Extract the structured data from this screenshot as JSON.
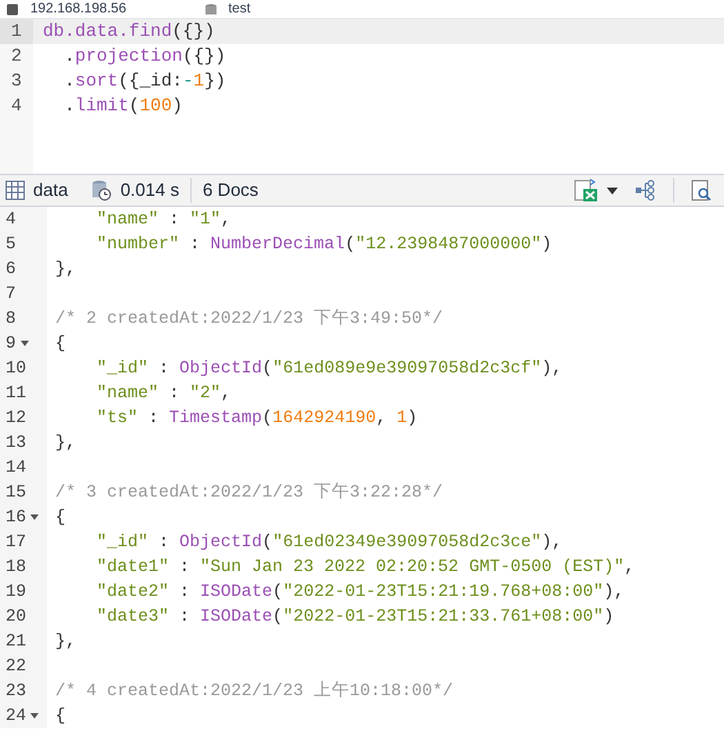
{
  "connection_bar": {
    "host": "192.168.198.56",
    "database": "test"
  },
  "editor": {
    "lines": [
      {
        "number": "1",
        "active": true,
        "tokens": [
          {
            "kind": "func",
            "text": "db.data.find"
          },
          {
            "kind": "plain",
            "text": "({})"
          }
        ]
      },
      {
        "number": "2",
        "active": false,
        "tokens": [
          {
            "kind": "plain",
            "text": "  ."
          },
          {
            "kind": "func",
            "text": "projection"
          },
          {
            "kind": "plain",
            "text": "({})"
          }
        ]
      },
      {
        "number": "3",
        "active": false,
        "tokens": [
          {
            "kind": "plain",
            "text": "  ."
          },
          {
            "kind": "func",
            "text": "sort"
          },
          {
            "kind": "plain",
            "text": "({_id:"
          },
          {
            "kind": "op",
            "text": "-"
          },
          {
            "kind": "number",
            "text": "1"
          },
          {
            "kind": "plain",
            "text": "})"
          }
        ]
      },
      {
        "number": "4",
        "active": false,
        "tokens": [
          {
            "kind": "plain",
            "text": "  ."
          },
          {
            "kind": "func",
            "text": "limit"
          },
          {
            "kind": "plain",
            "text": "("
          },
          {
            "kind": "number",
            "text": "100"
          },
          {
            "kind": "plain",
            "text": ")"
          }
        ]
      }
    ]
  },
  "toolbar": {
    "collection": "data",
    "time": "0.014 s",
    "count": "6 Docs"
  },
  "results": {
    "lines": [
      {
        "number": "4",
        "fold": false,
        "tokens": [
          {
            "kind": "string",
            "text": "    \"name\""
          },
          {
            "kind": "plain",
            "text": " : "
          },
          {
            "kind": "string",
            "text": "\"1\""
          },
          {
            "kind": "plain",
            "text": ","
          }
        ]
      },
      {
        "number": "5",
        "fold": false,
        "tokens": [
          {
            "kind": "string",
            "text": "    \"number\""
          },
          {
            "kind": "plain",
            "text": " : "
          },
          {
            "kind": "func",
            "text": "NumberDecimal"
          },
          {
            "kind": "plain",
            "text": "("
          },
          {
            "kind": "string",
            "text": "\"12.2398487000000\""
          },
          {
            "kind": "plain",
            "text": ")"
          }
        ]
      },
      {
        "number": "6",
        "fold": false,
        "tokens": [
          {
            "kind": "plain",
            "text": "},"
          }
        ]
      },
      {
        "number": "7",
        "fold": false
      },
      {
        "number": "8",
        "fold": false,
        "tokens": [
          {
            "kind": "comment",
            "text": "/* 2 createdAt:2022/1/23 下午3:49:50*/"
          }
        ]
      },
      {
        "number": "9",
        "fold": true,
        "tokens": [
          {
            "kind": "plain",
            "text": "{"
          }
        ]
      },
      {
        "number": "10",
        "fold": false,
        "tokens": [
          {
            "kind": "string",
            "text": "    \"_id\""
          },
          {
            "kind": "plain",
            "text": " : "
          },
          {
            "kind": "func",
            "text": "ObjectId"
          },
          {
            "kind": "plain",
            "text": "("
          },
          {
            "kind": "string",
            "text": "\"61ed089e9e39097058d2c3cf\""
          },
          {
            "kind": "plain",
            "text": "),"
          }
        ]
      },
      {
        "number": "11",
        "fold": false,
        "tokens": [
          {
            "kind": "string",
            "text": "    \"name\""
          },
          {
            "kind": "plain",
            "text": " : "
          },
          {
            "kind": "string",
            "text": "\"2\""
          },
          {
            "kind": "plain",
            "text": ","
          }
        ]
      },
      {
        "number": "12",
        "fold": false,
        "tokens": [
          {
            "kind": "string",
            "text": "    \"ts\""
          },
          {
            "kind": "plain",
            "text": " : "
          },
          {
            "kind": "func",
            "text": "Timestamp"
          },
          {
            "kind": "plain",
            "text": "("
          },
          {
            "kind": "number",
            "text": "1642924190"
          },
          {
            "kind": "plain",
            "text": ", "
          },
          {
            "kind": "number",
            "text": "1"
          },
          {
            "kind": "plain",
            "text": ")"
          }
        ]
      },
      {
        "number": "13",
        "fold": false,
        "tokens": [
          {
            "kind": "plain",
            "text": "},"
          }
        ]
      },
      {
        "number": "14",
        "fold": false
      },
      {
        "number": "15",
        "fold": false,
        "tokens": [
          {
            "kind": "comment",
            "text": "/* 3 createdAt:2022/1/23 下午3:22:28*/"
          }
        ]
      },
      {
        "number": "16",
        "fold": true,
        "tokens": [
          {
            "kind": "plain",
            "text": "{"
          }
        ]
      },
      {
        "number": "17",
        "fold": false,
        "tokens": [
          {
            "kind": "string",
            "text": "    \"_id\""
          },
          {
            "kind": "plain",
            "text": " : "
          },
          {
            "kind": "func",
            "text": "ObjectId"
          },
          {
            "kind": "plain",
            "text": "("
          },
          {
            "kind": "string",
            "text": "\"61ed02349e39097058d2c3ce\""
          },
          {
            "kind": "plain",
            "text": "),"
          }
        ]
      },
      {
        "number": "18",
        "fold": false,
        "tokens": [
          {
            "kind": "string",
            "text": "    \"date1\""
          },
          {
            "kind": "plain",
            "text": " : "
          },
          {
            "kind": "string",
            "text": "\"Sun Jan 23 2022 02:20:52 GMT-0500 (EST)\""
          },
          {
            "kind": "plain",
            "text": ","
          }
        ]
      },
      {
        "number": "19",
        "fold": false,
        "tokens": [
          {
            "kind": "string",
            "text": "    \"date2\""
          },
          {
            "kind": "plain",
            "text": " : "
          },
          {
            "kind": "func",
            "text": "ISODate"
          },
          {
            "kind": "plain",
            "text": "("
          },
          {
            "kind": "string",
            "text": "\"2022-01-23T15:21:19.768+08:00\""
          },
          {
            "kind": "plain",
            "text": "),"
          }
        ]
      },
      {
        "number": "20",
        "fold": false,
        "tokens": [
          {
            "kind": "string",
            "text": "    \"date3\""
          },
          {
            "kind": "plain",
            "text": " : "
          },
          {
            "kind": "func",
            "text": "ISODate"
          },
          {
            "kind": "plain",
            "text": "("
          },
          {
            "kind": "string",
            "text": "\"2022-01-23T15:21:33.761+08:00\""
          },
          {
            "kind": "plain",
            "text": ")"
          }
        ]
      },
      {
        "number": "21",
        "fold": false,
        "tokens": [
          {
            "kind": "plain",
            "text": "},"
          }
        ]
      },
      {
        "number": "22",
        "fold": false
      },
      {
        "number": "23",
        "fold": false,
        "tokens": [
          {
            "kind": "comment",
            "text": "/* 4 createdAt:2022/1/23 上午10:18:00*/"
          }
        ]
      },
      {
        "number": "24",
        "fold": true,
        "tokens": [
          {
            "kind": "plain",
            "text": "{"
          }
        ]
      }
    ]
  }
}
